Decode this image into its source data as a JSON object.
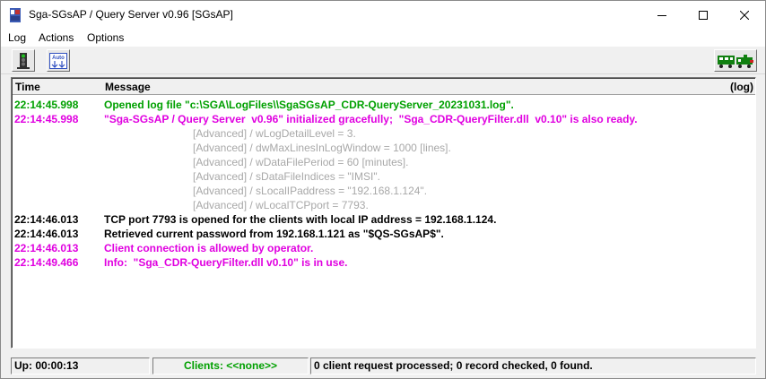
{
  "window": {
    "title": "Sga-SGsAP / Query Server  v0.96  [SGsAP]"
  },
  "menu": {
    "items": [
      {
        "label": "Log"
      },
      {
        "label": "Actions"
      },
      {
        "label": "Options"
      }
    ]
  },
  "toolbar": {
    "connect_icon": "traffic-light-icon",
    "auto_label": "Auto",
    "status_icon": "train-icon"
  },
  "log": {
    "header": {
      "time": "Time",
      "message": "Message",
      "log_label": "(log)"
    },
    "colors": {
      "green": "#00a000",
      "magenta": "#e000e0",
      "black": "#000000",
      "gray": "#a8a8a8"
    },
    "lines": [
      {
        "time": "22:14:45.998",
        "message": "Opened log file \"c:\\SGA\\LogFiles\\\\SgaSGsAP_CDR-QueryServer_20231031.log\".",
        "color": "#00a000"
      },
      {
        "time": "22:14:45.998",
        "message": "\"Sga-SGsAP / Query Server  v0.96\" initialized gracefully;  \"Sga_CDR-QueryFilter.dll  v0.10\" is also ready.",
        "color": "#e000e0"
      },
      {
        "time": "",
        "message": "[Advanced] / wLogDetailLevel = 3.",
        "color": "#a8a8a8"
      },
      {
        "time": "",
        "message": "[Advanced] / dwMaxLinesInLogWindow = 1000 [lines].",
        "color": "#a8a8a8"
      },
      {
        "time": "",
        "message": "[Advanced] / wDataFilePeriod = 60 [minutes].",
        "color": "#a8a8a8"
      },
      {
        "time": "",
        "message": "[Advanced] / sDataFileIndices = \"IMSI\".",
        "color": "#a8a8a8"
      },
      {
        "time": "",
        "message": "[Advanced] / sLocalIPaddress = \"192.168.1.124\".",
        "color": "#a8a8a8"
      },
      {
        "time": "",
        "message": "[Advanced] / wLocalTCPport = 7793.",
        "color": "#a8a8a8"
      },
      {
        "time": "22:14:46.013",
        "message": "TCP port 7793 is opened for the clients with local IP address = 192.168.1.124.",
        "color": "#000000"
      },
      {
        "time": "22:14:46.013",
        "message": "Retrieved current password from 192.168.1.121 as \"$QS-SGsAP$\".",
        "color": "#000000"
      },
      {
        "time": "22:14:46.013",
        "message": "Client connection is allowed by operator.",
        "color": "#e000e0"
      },
      {
        "time": "22:14:49.466",
        "message": "Info:  \"Sga_CDR-QueryFilter.dll v0.10\" is in use.",
        "color": "#e000e0"
      }
    ]
  },
  "status": {
    "uptime": "Up: 00:00:13",
    "clients": "Clients: <<none>>",
    "clients_color": "#00a000",
    "requests": "0 client request processed;  0 record checked, 0 found."
  }
}
